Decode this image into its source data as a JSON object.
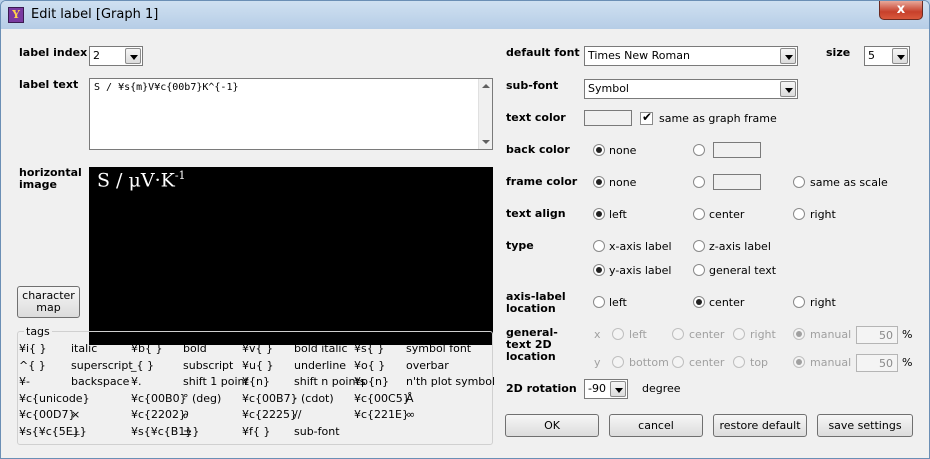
{
  "window": {
    "title": "Edit label [Graph 1]",
    "close_glyph": "x",
    "app_icon_glyph": "Y"
  },
  "left": {
    "label_index": {
      "label": "label index",
      "value": "2"
    },
    "label_text": {
      "label": "label text",
      "value": "S / ¥s{m}V¥c{00b7}K^{-1}"
    },
    "horizontal_image": {
      "label_line1": "horizontal",
      "label_line2": "image",
      "preview_main": "S / μV·K",
      "preview_sup": "-1"
    },
    "character_map": {
      "line1": "character",
      "line2": "map"
    },
    "tags": {
      "title": "tags",
      "rows": [
        [
          [
            "¥i{ }",
            "italic"
          ],
          [
            "¥b{ }",
            "bold"
          ],
          [
            "¥v{ }",
            "bold italic"
          ],
          [
            "¥s{ }",
            "symbol font"
          ]
        ],
        [
          [
            "^{ }",
            "superscript"
          ],
          [
            "_{ }",
            "subscript"
          ],
          [
            "¥u{ }",
            "underline"
          ],
          [
            "¥o{ }",
            "overbar"
          ]
        ],
        [
          [
            "¥-",
            "backspace"
          ],
          [
            "¥.",
            "shift 1 point"
          ],
          [
            "¥{n}",
            "shift n points"
          ],
          [
            "¥p{n}",
            "n'th plot symbol"
          ]
        ],
        [
          [
            "¥c{unicode}",
            ""
          ],
          [
            "¥c{00B0}",
            "° (deg)"
          ],
          [
            "¥c{00B7}",
            "· (cdot)"
          ],
          [
            "¥c{00C5}",
            "Å"
          ]
        ],
        [
          [
            "¥c{00D7}",
            "×"
          ],
          [
            "¥c{2202}",
            "∂"
          ],
          [
            "¥c{2225}",
            "//"
          ],
          [
            "¥c{221E}",
            "∞"
          ]
        ],
        [
          [
            "¥s{¥c{5E}}",
            "⊥"
          ],
          [
            "¥s{¥c{B1}}",
            "±"
          ],
          [
            "¥f{ }",
            "sub-font"
          ],
          [
            "",
            ""
          ]
        ]
      ]
    }
  },
  "right": {
    "default_font": {
      "label": "default font",
      "value": "Times New Roman"
    },
    "size": {
      "label": "size",
      "value": "5"
    },
    "sub_font": {
      "label": "sub-font",
      "value": "Symbol"
    },
    "text_color": {
      "label": "text color",
      "same_as_graph_frame": "same as graph frame"
    },
    "back_color": {
      "label": "back color",
      "none": "none"
    },
    "frame_color": {
      "label": "frame color",
      "none": "none",
      "same_as_scale": "same as scale"
    },
    "text_align": {
      "label": "text align",
      "left": "left",
      "center": "center",
      "right": "right"
    },
    "type": {
      "label": "type",
      "x_axis": "x-axis label",
      "z_axis": "z-axis label",
      "y_axis": "y-axis label",
      "general": "general text"
    },
    "axis_label_location": {
      "label_line1": "axis-label",
      "label_line2": "location",
      "left": "left",
      "center": "center",
      "right": "right"
    },
    "general_text_location": {
      "label_line1": "general-",
      "label_line2": "text 2D",
      "label_line3": "location",
      "x": {
        "axis": "x",
        "left": "left",
        "center": "center",
        "right": "right",
        "manual": "manual",
        "value": "50",
        "unit": "%"
      },
      "y": {
        "axis": "y",
        "bottom": "bottom",
        "center": "center",
        "top": "top",
        "manual": "manual",
        "value": "50",
        "unit": "%"
      }
    },
    "rotation": {
      "label": "2D rotation",
      "value": "-90",
      "unit": "degree"
    },
    "buttons": {
      "ok": "OK",
      "cancel": "cancel",
      "restore": "restore default",
      "save": "save settings"
    }
  }
}
